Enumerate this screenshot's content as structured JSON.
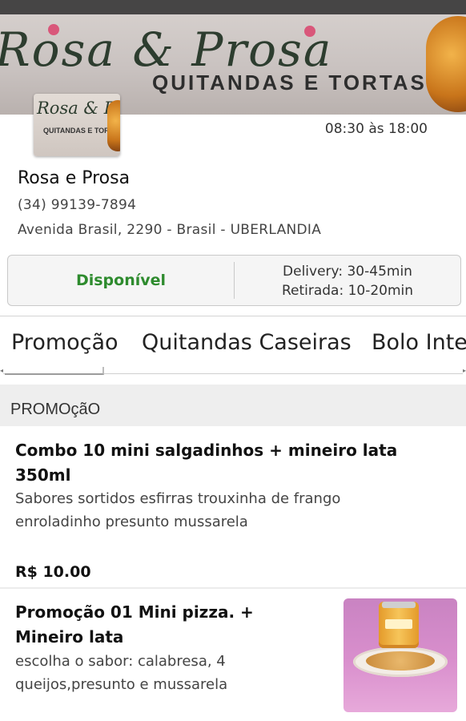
{
  "banner": {
    "brand_text": "Rosa & Prosa",
    "subtitle": "QUITANDAS E TORTAS"
  },
  "logo": {
    "brand_text": "Rosa & Prosa",
    "subtitle": "QUITANDAS E TORTAS"
  },
  "store": {
    "hours": "08:30 às 18:00",
    "name": "Rosa e Prosa",
    "phone": "(34) 99139-7894",
    "address": "Avenida Brasil, 2290 - Brasil - UBERLANDIA",
    "status": "Disponível",
    "delivery": "Delivery: 30-45min",
    "pickup": "Retirada: 10-20min",
    "status_color": "#2e8b2e"
  },
  "tabs": [
    {
      "label": "Promoção"
    },
    {
      "label": "Quitandas Caseiras"
    },
    {
      "label": "Bolo Inte"
    }
  ],
  "section": {
    "title": "PROMOçãO"
  },
  "products": [
    {
      "title": "Combo 10 mini salgadinhos + mineiro lata 350ml",
      "description": "Sabores sortidos esfirras trouxinha de frango enroladinho presunto mussarela",
      "price": "R$ 10.00"
    },
    {
      "title": "Promoção 01 Mini pizza. + Mineiro lata",
      "description": "escolha o sabor: calabresa, 4 queijos,presunto e mussarela",
      "image_label": "MINEIRO"
    }
  ]
}
